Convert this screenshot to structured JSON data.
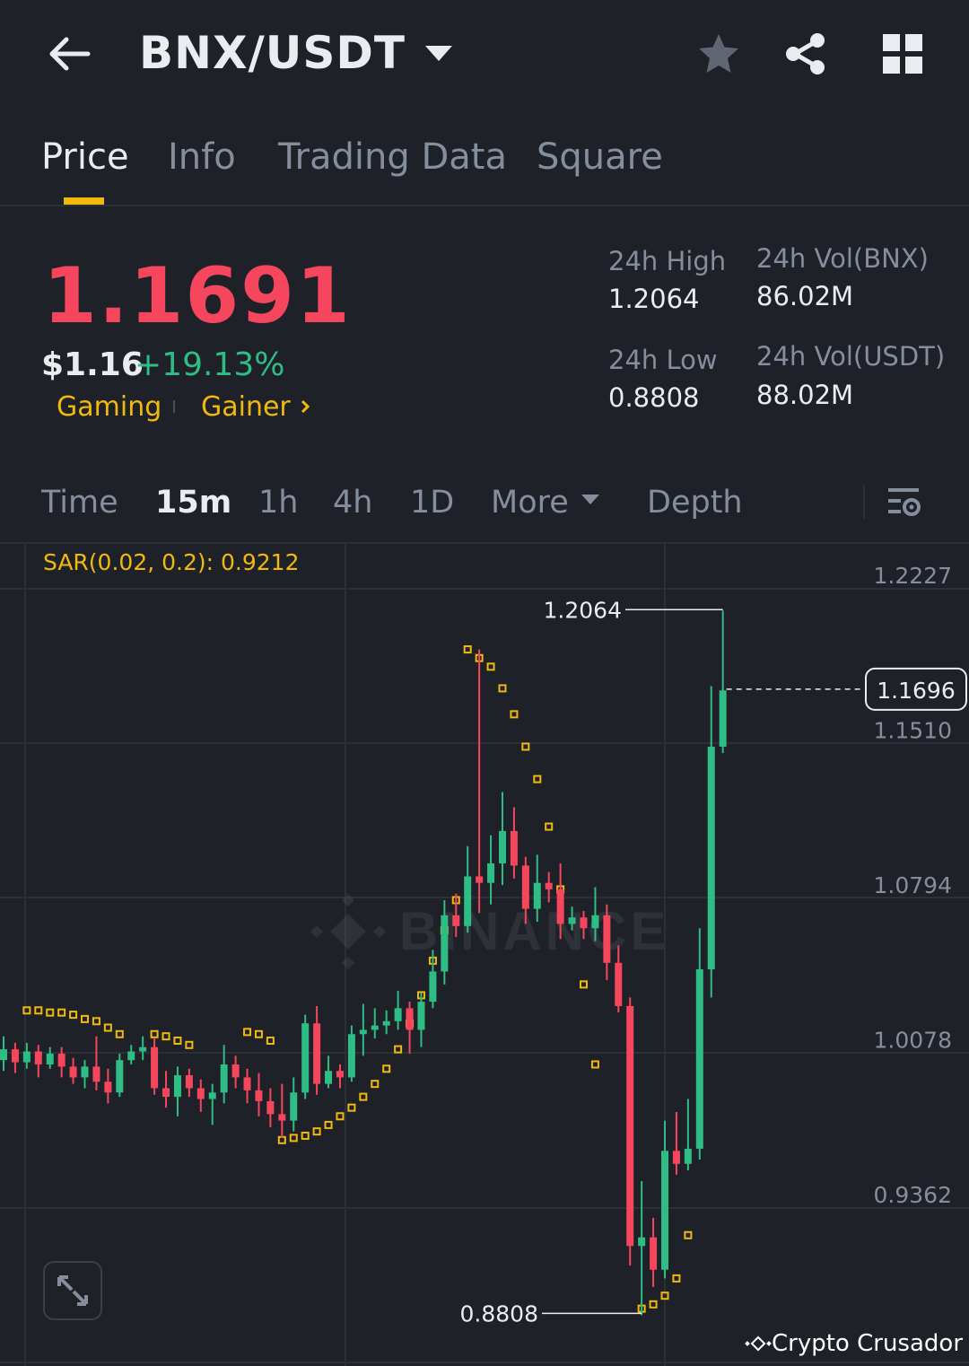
{
  "header": {
    "pair": "BNX/USDT"
  },
  "tabs": [
    {
      "label": "Price",
      "active": true
    },
    {
      "label": "Info",
      "active": false
    },
    {
      "label": "Trading Data",
      "active": false
    },
    {
      "label": "Square",
      "active": false
    }
  ],
  "ticker": {
    "last_price": "1.1691",
    "usd_price": "$1.16",
    "change_pct": "+19.13%",
    "tags": [
      "Gaming",
      "Gainer"
    ],
    "stats": {
      "high_label": "24h High",
      "high": "1.2064",
      "low_label": "24h Low",
      "low": "0.8808",
      "vol_base_label": "24h Vol(BNX)",
      "vol_base": "86.02M",
      "vol_quote_label": "24h Vol(USDT)",
      "vol_quote": "88.02M"
    }
  },
  "intervals": {
    "time": "Time",
    "options": [
      "15m",
      "1h",
      "4h",
      "1D"
    ],
    "active": "15m",
    "more": "More",
    "depth": "Depth"
  },
  "chart_data": {
    "type": "candlestick",
    "indicator": "SAR(0.02, 0.2): 0.9212",
    "y_ticks": [
      "1.2227",
      "1.1510",
      "1.0794",
      "1.0078",
      "0.9362"
    ],
    "ylim": [
      0.865,
      1.245
    ],
    "current_price": "1.1696",
    "high_marker": "1.2064",
    "low_marker": "0.8808",
    "watermark": "BINANCE",
    "up_color": "#2ebd85",
    "down_color": "#f6465d",
    "sar_color": "#f0b90b",
    "candles": [
      [
        0.998,
        1.003,
        1.009,
        0.993
      ],
      [
        1.003,
        0.997,
        1.006,
        0.992
      ],
      [
        0.997,
        1.002,
        1.006,
        0.994
      ],
      [
        1.002,
        0.996,
        1.005,
        0.99
      ],
      [
        0.996,
        1.001,
        1.004,
        0.994
      ],
      [
        1.001,
        0.995,
        1.004,
        0.99
      ],
      [
        0.995,
        0.99,
        0.999,
        0.987
      ],
      [
        0.99,
        0.995,
        0.998,
        0.985
      ],
      [
        0.995,
        0.988,
        1.009,
        0.984
      ],
      [
        0.988,
        0.983,
        0.994,
        0.978
      ],
      [
        0.983,
        0.998,
        1.001,
        0.981
      ],
      [
        0.998,
        1.002,
        1.005,
        0.996
      ],
      [
        1.002,
        1.004,
        1.009,
        0.998
      ],
      [
        1.004,
        0.985,
        1.008,
        0.982
      ],
      [
        0.985,
        0.981,
        0.993,
        0.976
      ],
      [
        0.981,
        0.991,
        0.995,
        0.972
      ],
      [
        0.991,
        0.985,
        0.994,
        0.981
      ],
      [
        0.985,
        0.98,
        0.989,
        0.974
      ],
      [
        0.98,
        0.983,
        0.987,
        0.968
      ],
      [
        0.983,
        0.996,
        1.005,
        0.978
      ],
      [
        0.996,
        0.99,
        1.0,
        0.985
      ],
      [
        0.99,
        0.984,
        0.994,
        0.978
      ],
      [
        0.984,
        0.979,
        0.992,
        0.972
      ],
      [
        0.979,
        0.973,
        0.985,
        0.967
      ],
      [
        0.973,
        0.97,
        0.987,
        0.962
      ],
      [
        0.97,
        0.983,
        0.99,
        0.965
      ],
      [
        0.983,
        1.015,
        1.019,
        0.98
      ],
      [
        1.015,
        0.987,
        1.023,
        0.982
      ],
      [
        0.987,
        0.993,
        1.0,
        0.985
      ],
      [
        0.993,
        0.99,
        0.996,
        0.985
      ],
      [
        0.99,
        1.01,
        1.014,
        0.988
      ],
      [
        1.01,
        1.012,
        1.024,
        1.0
      ],
      [
        1.012,
        1.014,
        1.022,
        1.008
      ],
      [
        1.014,
        1.016,
        1.021,
        1.01
      ],
      [
        1.016,
        1.022,
        1.03,
        1.012
      ],
      [
        1.022,
        1.012,
        1.025,
        1.001
      ],
      [
        1.012,
        1.025,
        1.029,
        1.004
      ],
      [
        1.025,
        1.039,
        1.049,
        1.022
      ],
      [
        1.039,
        1.065,
        1.072,
        1.033
      ],
      [
        1.065,
        1.06,
        1.075,
        1.055
      ],
      [
        1.06,
        1.083,
        1.097,
        1.057
      ],
      [
        1.083,
        1.08,
        1.188,
        1.066
      ],
      [
        1.08,
        1.089,
        1.102,
        1.07
      ],
      [
        1.089,
        1.104,
        1.122,
        1.079
      ],
      [
        1.104,
        1.088,
        1.115,
        1.082
      ],
      [
        1.088,
        1.068,
        1.092,
        1.061
      ],
      [
        1.068,
        1.08,
        1.093,
        1.062
      ],
      [
        1.08,
        1.077,
        1.085,
        1.071
      ],
      [
        1.077,
        1.061,
        1.089,
        1.054
      ],
      [
        1.061,
        1.064,
        1.069,
        1.058
      ],
      [
        1.064,
        1.059,
        1.067,
        1.054
      ],
      [
        1.059,
        1.065,
        1.078,
        1.053
      ],
      [
        1.065,
        1.043,
        1.07,
        1.035
      ],
      [
        1.043,
        1.023,
        1.051,
        1.02
      ],
      [
        1.023,
        0.912,
        1.027,
        0.903
      ],
      [
        0.912,
        0.916,
        0.942,
        0.88
      ],
      [
        0.916,
        0.901,
        0.925,
        0.893
      ],
      [
        0.901,
        0.956,
        0.97,
        0.897
      ],
      [
        0.956,
        0.95,
        0.974,
        0.945
      ],
      [
        0.95,
        0.957,
        0.98,
        0.947
      ],
      [
        0.957,
        1.04,
        1.059,
        0.952
      ],
      [
        1.04,
        1.143,
        1.171,
        1.027
      ],
      [
        1.143,
        1.169,
        1.206,
        1.14
      ]
    ],
    "sar": [
      {
        "i": 2,
        "v": 1.021
      },
      {
        "i": 3,
        "v": 1.021
      },
      {
        "i": 4,
        "v": 1.02
      },
      {
        "i": 5,
        "v": 1.02
      },
      {
        "i": 6,
        "v": 1.019
      },
      {
        "i": 7,
        "v": 1.017
      },
      {
        "i": 8,
        "v": 1.016
      },
      {
        "i": 9,
        "v": 1.013
      },
      {
        "i": 10,
        "v": 1.01
      },
      {
        "i": 13,
        "v": 1.01
      },
      {
        "i": 14,
        "v": 1.009
      },
      {
        "i": 15,
        "v": 1.007
      },
      {
        "i": 16,
        "v": 1.005
      },
      {
        "i": 21,
        "v": 1.011
      },
      {
        "i": 22,
        "v": 1.01
      },
      {
        "i": 23,
        "v": 1.007
      },
      {
        "i": 24,
        "v": 0.961
      },
      {
        "i": 25,
        "v": 0.962
      },
      {
        "i": 26,
        "v": 0.963
      },
      {
        "i": 27,
        "v": 0.965
      },
      {
        "i": 28,
        "v": 0.968
      },
      {
        "i": 29,
        "v": 0.972
      },
      {
        "i": 30,
        "v": 0.976
      },
      {
        "i": 31,
        "v": 0.981
      },
      {
        "i": 32,
        "v": 0.987
      },
      {
        "i": 33,
        "v": 0.994
      },
      {
        "i": 34,
        "v": 1.003
      },
      {
        "i": 35,
        "v": 1.015
      },
      {
        "i": 36,
        "v": 1.028
      },
      {
        "i": 37,
        "v": 1.044
      },
      {
        "i": 38,
        "v": 1.058
      },
      {
        "i": 39,
        "v": 1.072
      },
      {
        "i": 40,
        "v": 1.188
      },
      {
        "i": 41,
        "v": 1.184
      },
      {
        "i": 42,
        "v": 1.18
      },
      {
        "i": 43,
        "v": 1.17
      },
      {
        "i": 44,
        "v": 1.158
      },
      {
        "i": 45,
        "v": 1.143
      },
      {
        "i": 46,
        "v": 1.128
      },
      {
        "i": 47,
        "v": 1.106
      },
      {
        "i": 48,
        "v": 1.077
      },
      {
        "i": 50,
        "v": 1.033
      },
      {
        "i": 51,
        "v": 0.996
      },
      {
        "i": 55,
        "v": 0.883
      },
      {
        "i": 56,
        "v": 0.885
      },
      {
        "i": 57,
        "v": 0.889
      },
      {
        "i": 58,
        "v": 0.897
      },
      {
        "i": 59,
        "v": 0.917
      }
    ]
  },
  "footer": {
    "signature": "Crypto Crusador"
  }
}
